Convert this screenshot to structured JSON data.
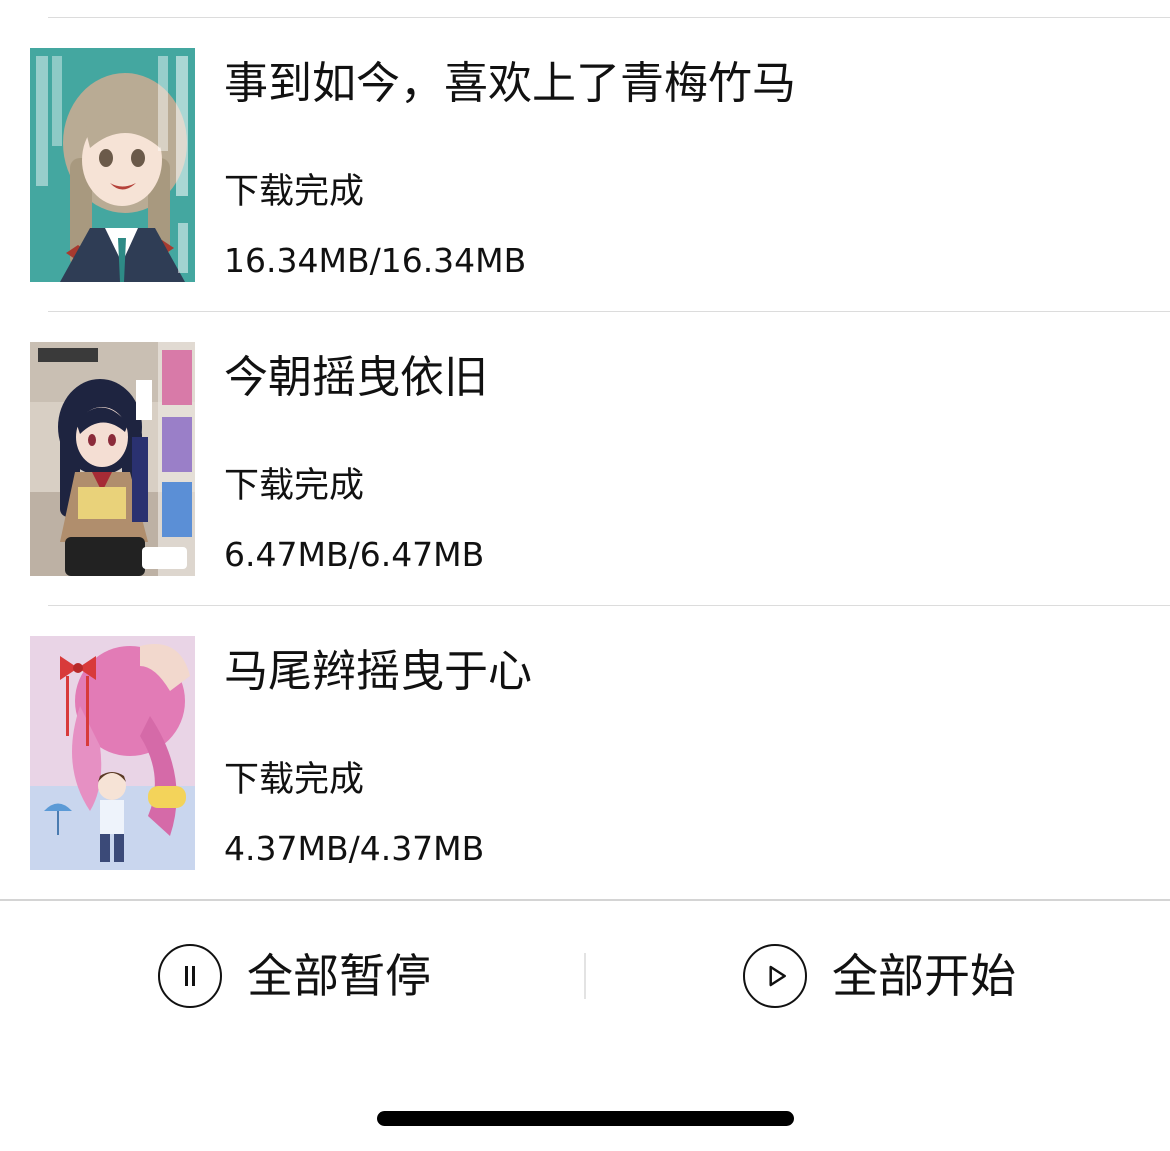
{
  "downloads": [
    {
      "title": "事到如今，喜欢上了青梅竹马",
      "status": "下载完成",
      "size": "16.34MB/16.34MB",
      "cover_icon": "manga-cover-teal-girl-braids",
      "cover_colors": {
        "bg": "#3fa39c",
        "accent": "#a83a2f"
      }
    },
    {
      "title": "今朝摇曳依旧",
      "status": "下载完成",
      "size": "6.47MB/6.47MB",
      "cover_icon": "manga-cover-dark-hair-girl-reading",
      "cover_colors": {
        "bg": "#d8cfc4",
        "accent": "#1e2440"
      }
    },
    {
      "title": "马尾辫摇曳于心",
      "status": "下载完成",
      "size": "4.37MB/4.37MB",
      "cover_icon": "manga-cover-pink-ponytail",
      "cover_colors": {
        "bg": "#e9d4e6",
        "accent": "#e27bb6"
      }
    }
  ],
  "bottom_bar": {
    "pause_all_label": "全部暂停",
    "start_all_label": "全部开始",
    "pause_icon": "pause-circle-icon",
    "start_icon": "play-circle-icon"
  }
}
